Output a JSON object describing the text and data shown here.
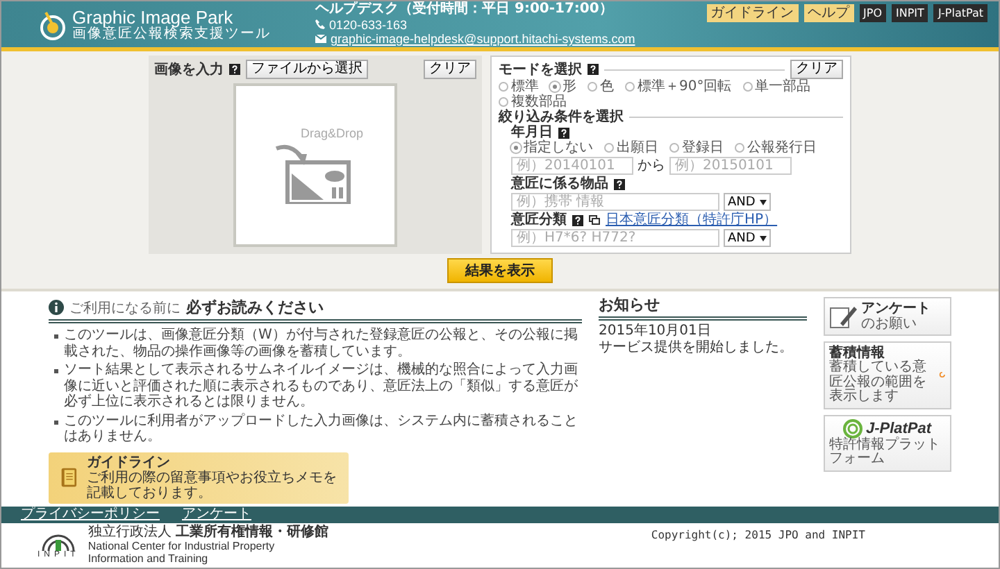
{
  "header": {
    "logo_title": "Graphic Image Park",
    "logo_subtitle": "画像意匠公報検索支援ツール",
    "helpdesk": "ヘルプデスク（受付時間：平日 9:00-17:00）",
    "phone": "0120-633-163",
    "email": "graphic-image-helpdesk@support.hitachi-systems.com",
    "nav_buttons": [
      {
        "label": "ガイドライン",
        "kind": "light"
      },
      {
        "label": "ヘルプ",
        "kind": "light"
      },
      {
        "label": "JPO",
        "kind": "dark"
      },
      {
        "label": "INPIT",
        "kind": "dark"
      },
      {
        "label": "J-PlatPat",
        "kind": "dark"
      }
    ]
  },
  "image_input": {
    "label": "画像を入力",
    "file_button": "ファイルから選択",
    "clear_button": "クリア",
    "drop_text": "Drag&Drop",
    "submit_button": "結果を表示"
  },
  "mode": {
    "clear_button": "クリア",
    "title": "モードを選択",
    "options": [
      {
        "label": "標準",
        "selected": false
      },
      {
        "label": "形",
        "selected": true
      },
      {
        "label": "色",
        "selected": false
      },
      {
        "label": "標準＋90°回転",
        "selected": false
      },
      {
        "label": "単一部品",
        "selected": false
      },
      {
        "label": "複数部品",
        "selected": false
      }
    ]
  },
  "filter": {
    "title": "絞り込み条件を選択",
    "date": {
      "label": "年月日",
      "options": [
        {
          "label": "指定しない",
          "selected": true
        },
        {
          "label": "出願日",
          "selected": false
        },
        {
          "label": "登録日",
          "selected": false
        },
        {
          "label": "公報発行日",
          "selected": false
        }
      ],
      "from_placeholder": "例）20140101",
      "separator": "から",
      "to_placeholder": "例）20150101"
    },
    "goods": {
      "label": "意匠に係る物品",
      "placeholder": "例）携帯 情報",
      "operator": "AND"
    },
    "classification": {
      "label": "意匠分類",
      "link": "日本意匠分類（特許庁HP）",
      "placeholder": "例）H7*6? H772?",
      "operator": "AND"
    }
  },
  "notice": {
    "lead": "ご利用になる前に",
    "title": "必ずお読みください",
    "bullets": [
      "このツールは、画像意匠分類（W）が付与された登録意匠の公報と、その公報に掲載された、物品の操作画像等の画像を蓄積しています。",
      "ソート結果として表示されるサムネイルイメージは、機械的な照合によって入力画像に近いと評価された順に表示されるものであり、意匠法上の「類似」する意匠が必ず上位に表示されるとは限りません。",
      "このツールに利用者がアップロードした入力画像は、システム内に蓄積されることはありません。"
    ]
  },
  "guideline": {
    "title": "ガイドライン",
    "description": "ご利用の際の留意事項やお役立ちメモを記載しております。"
  },
  "news": {
    "title": "お知らせ",
    "date": "2015年10月01日",
    "text": "サービス提供を開始しました。"
  },
  "side_banners": [
    {
      "kind": "survey",
      "title": "アンケート",
      "subtitle": "のお願い"
    },
    {
      "kind": "accumulation",
      "title": "蓄積情報",
      "subtitle": "蓄積している意匠公報の範囲を表示します"
    },
    {
      "kind": "jplatpat",
      "title": "J-PlatPat",
      "subtitle": "特許情報プラットフォーム"
    }
  ],
  "footer": {
    "links": [
      "プライバシーポリシー",
      "アンケート"
    ],
    "logo_text": "INPIT",
    "org_small": "独立行政法人",
    "org_name": "工業所有権情報・研修館",
    "org_english": "National Center for Industrial Property Information and Training",
    "copyright": "Copyright(c); 2015 JPO and INPIT"
  }
}
